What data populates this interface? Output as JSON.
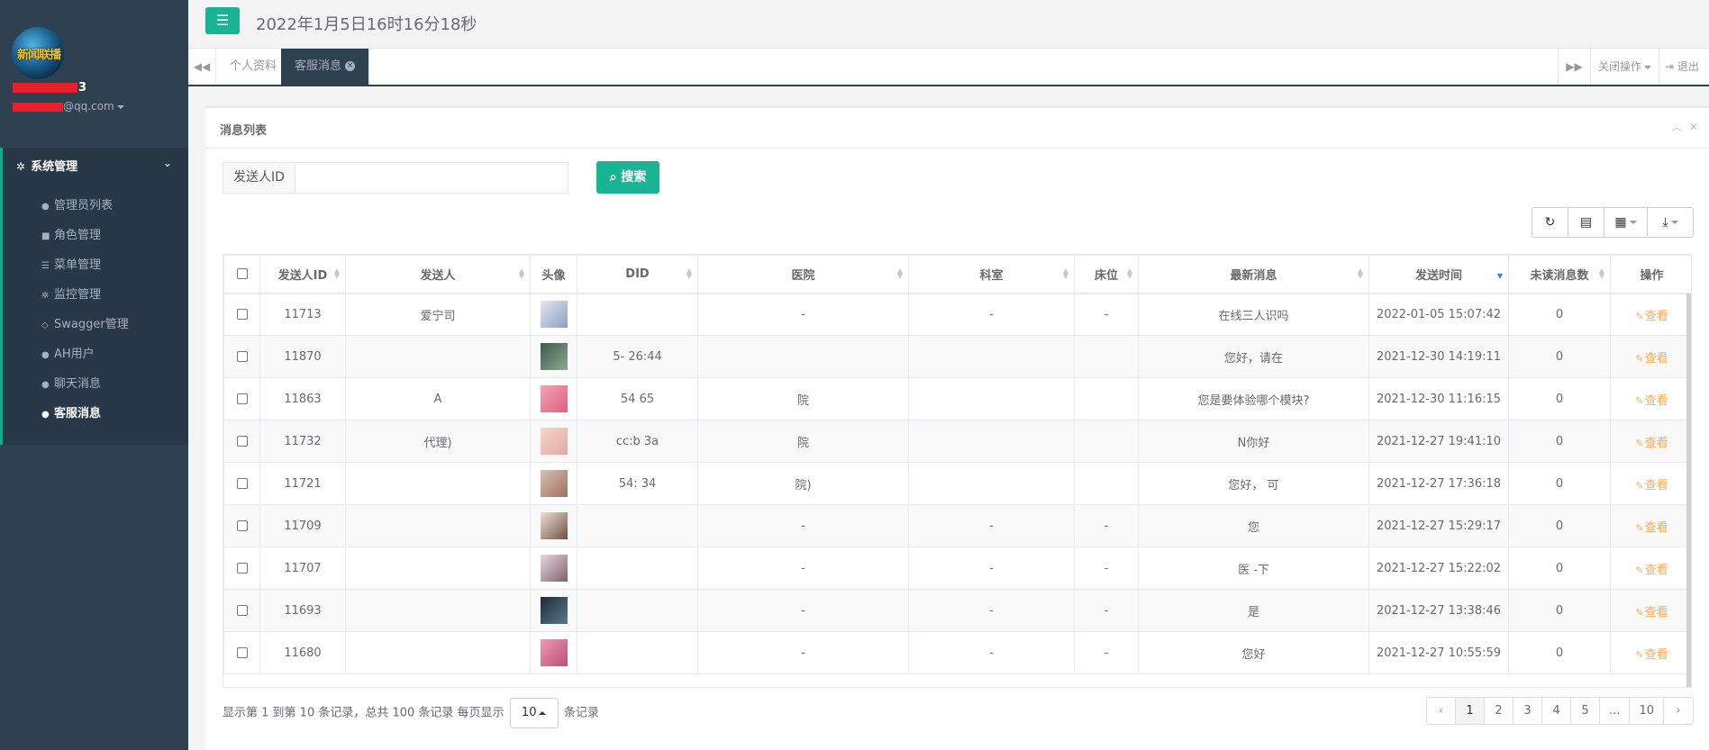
{
  "header": {
    "datetime": "2022年1月5日16时16分18秒"
  },
  "sidebar": {
    "logo_text": "新闻联播",
    "user_name_suffix": "3",
    "user_email_suffix": "@qq.com",
    "section_title": "系统管理",
    "items": [
      {
        "label": "管理员列表",
        "icon": "user-icon"
      },
      {
        "label": "角色管理",
        "icon": "lock-icon"
      },
      {
        "label": "菜单管理",
        "icon": "list-icon"
      },
      {
        "label": "监控管理",
        "icon": "cogs-icon"
      },
      {
        "label": "Swagger管理",
        "icon": "diamond-icon"
      },
      {
        "label": "AH用户",
        "icon": "user-icon"
      },
      {
        "label": "聊天消息",
        "icon": "user-icon"
      },
      {
        "label": "客服消息",
        "icon": "user-icon"
      }
    ]
  },
  "tabs": [
    {
      "label": "个人资料"
    },
    {
      "label": "客服消息"
    }
  ],
  "tab_actions": {
    "close_ops": "关闭操作",
    "logout": "退出"
  },
  "panel": {
    "title": "消息列表"
  },
  "search": {
    "label": "发送人ID",
    "value": "",
    "button": "搜索"
  },
  "table": {
    "columns": [
      "发送人ID",
      "发送人",
      "头像",
      "DID",
      "医院",
      "科室",
      "床位",
      "最新消息",
      "发送时间",
      "未读消息数",
      "操作"
    ],
    "rows": [
      {
        "id": "11713",
        "sender": "爱宁司",
        "did": "",
        "hospital": "-",
        "dept": "-",
        "bed": "-",
        "msg": "在线三人识吗",
        "time": "2022-01-05 15:07:42",
        "unread": "0",
        "action": "查看"
      },
      {
        "id": "11870",
        "sender": "",
        "did": "5-   26:44",
        "hospital": "",
        "dept": "",
        "bed": "",
        "msg": "您好，请在",
        "time": "2021-12-30 14:19:11",
        "unread": "0",
        "action": "查看"
      },
      {
        "id": "11863",
        "sender": "A",
        "did": "54   65",
        "hospital": "院",
        "dept": "",
        "bed": "",
        "msg": "您是要体验哪个模块?",
        "time": "2021-12-30 11:16:15",
        "unread": "0",
        "action": "查看"
      },
      {
        "id": "11732",
        "sender": "代理)",
        "did": "cc:b   3a",
        "hospital": "院",
        "dept": "",
        "bed": "",
        "msg": "N你好",
        "time": "2021-12-27 19:41:10",
        "unread": "0",
        "action": "查看"
      },
      {
        "id": "11721",
        "sender": "",
        "did": "54:   34",
        "hospital": "院)",
        "dept": "",
        "bed": "",
        "msg": "您好，   可",
        "time": "2021-12-27 17:36:18",
        "unread": "0",
        "action": "查看"
      },
      {
        "id": "11709",
        "sender": "",
        "did": "",
        "hospital": "-",
        "dept": "-",
        "bed": "-",
        "msg": "您",
        "time": "2021-12-27 15:29:17",
        "unread": "0",
        "action": "查看"
      },
      {
        "id": "11707",
        "sender": "",
        "did": "",
        "hospital": "-",
        "dept": "-",
        "bed": "-",
        "msg": "医   -下",
        "time": "2021-12-27 15:22:02",
        "unread": "0",
        "action": "查看"
      },
      {
        "id": "11693",
        "sender": "",
        "did": "",
        "hospital": "-",
        "dept": "-",
        "bed": "-",
        "msg": "是",
        "time": "2021-12-27 13:38:46",
        "unread": "0",
        "action": "查看"
      },
      {
        "id": "11680",
        "sender": "",
        "did": "",
        "hospital": "-",
        "dept": "-",
        "bed": "-",
        "msg": "您好",
        "time": "2021-12-27 10:55:59",
        "unread": "0",
        "action": "查看"
      }
    ]
  },
  "footer": {
    "info_prefix": "显示第 1 到第 10 条记录，总共 100 条记录 每页显示",
    "page_size": "10",
    "info_suffix": "条记录",
    "pages": [
      "1",
      "2",
      "3",
      "4",
      "5",
      "...",
      "10"
    ],
    "prev": "‹",
    "next": "›"
  },
  "colors": {
    "accent": "#1ab394",
    "sidebar": "#2f4050",
    "action": "#f8ac59"
  }
}
